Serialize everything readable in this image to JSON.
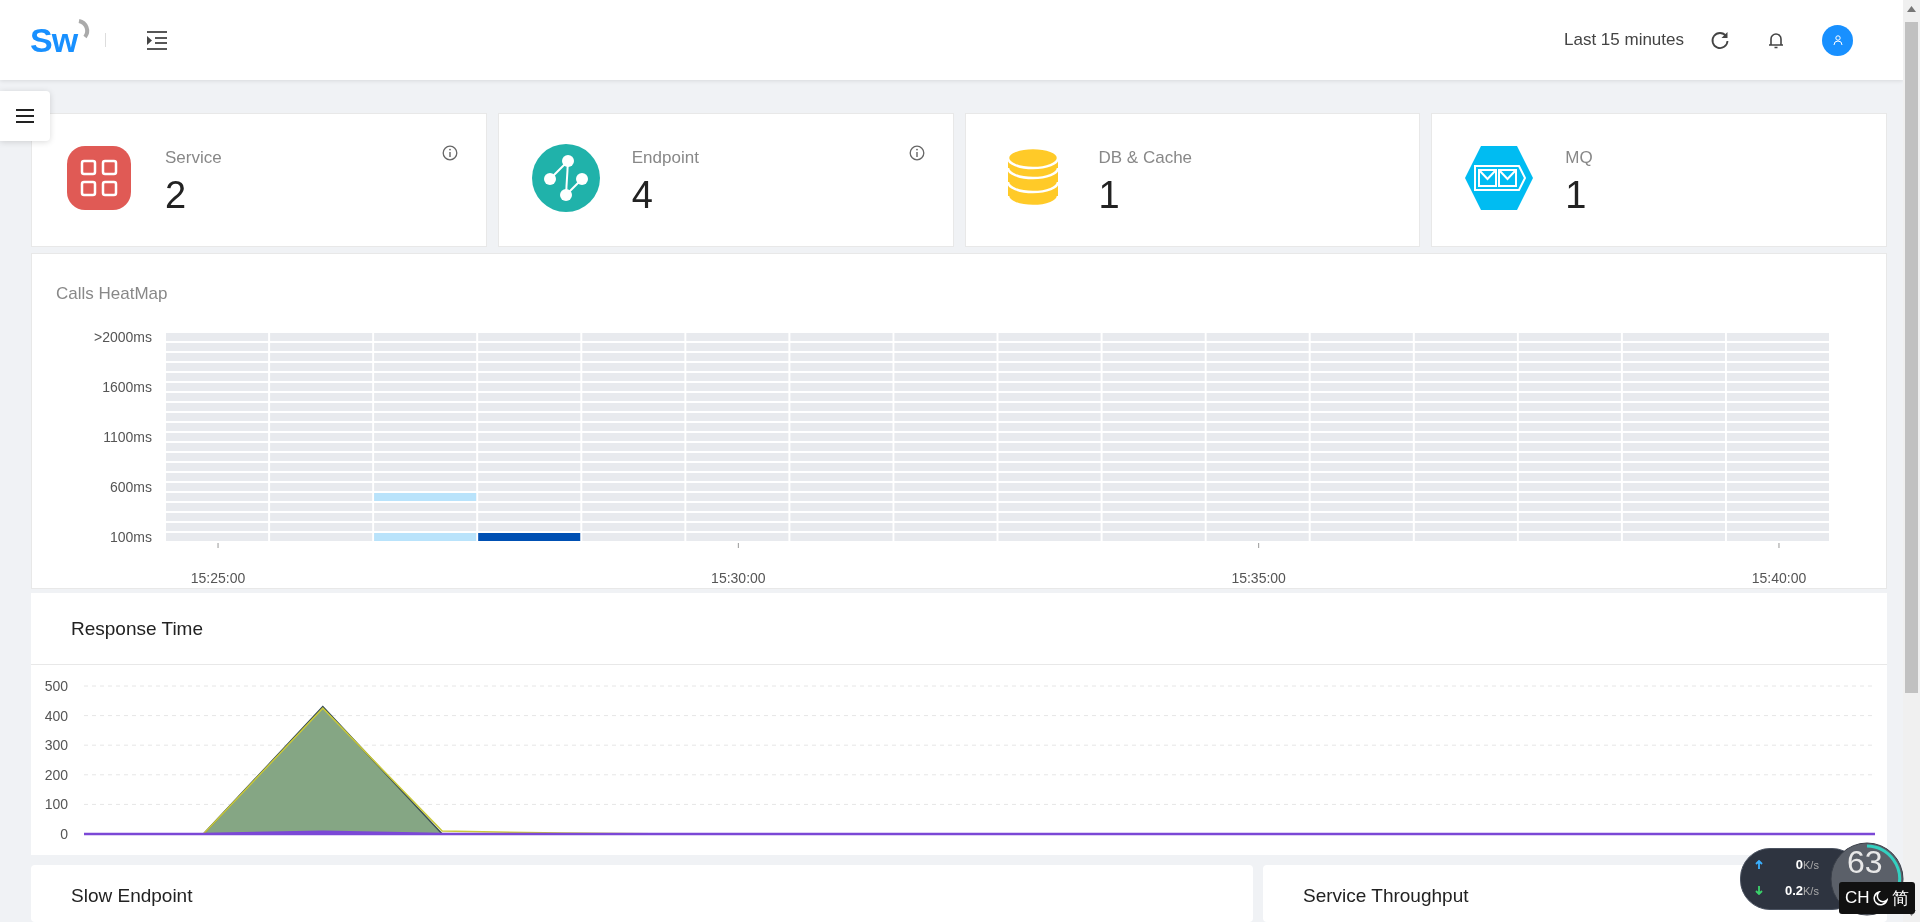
{
  "header": {
    "logo": "Sw",
    "time_range": "Last 15 minutes"
  },
  "cards": [
    {
      "kind": "service",
      "label": "Service",
      "value": "2",
      "info": true
    },
    {
      "kind": "endpoint",
      "label": "Endpoint",
      "value": "4",
      "info": true
    },
    {
      "kind": "database",
      "label": "DB & Cache",
      "value": "1",
      "info": false
    },
    {
      "kind": "mq",
      "label": "MQ",
      "value": "1",
      "info": false
    }
  ],
  "heatmap": {
    "title": "Calls HeatMap",
    "y_labels": [
      ">2000ms",
      "1600ms",
      "1100ms",
      "600ms",
      "100ms"
    ],
    "x_labels": [
      "15:25:00",
      "15:30:00",
      "15:35:00",
      "15:40:00"
    ]
  },
  "response_time": {
    "title": "Response Time",
    "chart_data": {
      "type": "area",
      "ylim": [
        0,
        500
      ],
      "yticks": [
        0,
        100,
        200,
        300,
        400,
        500
      ],
      "series": [
        {
          "color": "#7fa38a",
          "values": [
            0,
            0,
            430,
            0,
            0,
            0,
            0,
            0,
            0,
            0,
            0,
            0,
            0,
            0,
            0,
            0
          ]
        },
        {
          "color": "#c9c93a",
          "values": [
            0,
            0,
            425,
            10,
            3,
            0,
            0,
            0,
            0,
            0,
            0,
            0,
            0,
            0,
            0,
            0
          ]
        },
        {
          "color": "#7b48d6",
          "values": [
            0,
            0,
            8,
            0,
            0,
            0,
            0,
            0,
            0,
            0,
            0,
            0,
            0,
            0,
            0,
            0
          ]
        }
      ],
      "grid": true
    }
  },
  "panels": [
    {
      "title": "Slow Endpoint"
    },
    {
      "title": "Service Throughput"
    }
  ],
  "net_monitor": {
    "upload": {
      "value": "0",
      "unit": "K/s"
    },
    "download": {
      "value": "0.2",
      "unit": "K/s"
    },
    "load": "63"
  },
  "ime_bar": {
    "lang": "CH",
    "mode": "简"
  }
}
